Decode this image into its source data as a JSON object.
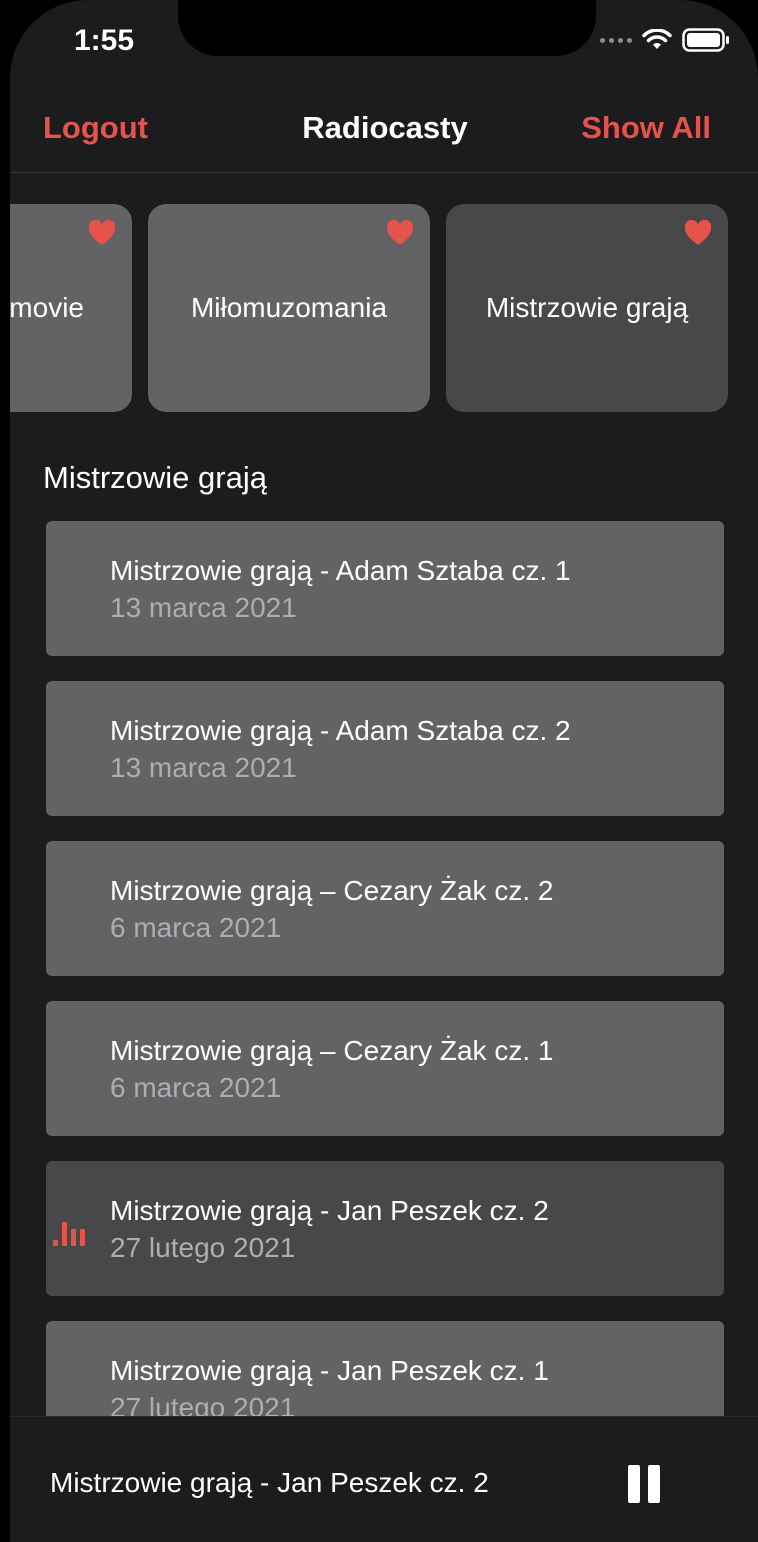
{
  "status": {
    "time": "1:55"
  },
  "navbar": {
    "left": "Logout",
    "title": "Radiocasty",
    "right": "Show All"
  },
  "colors": {
    "accent": "#e5534b",
    "card": "#636366",
    "card_selected": "#48484a",
    "background": "#1c1c1e"
  },
  "carousel": {
    "items": [
      {
        "label": "movie",
        "favorite": true
      },
      {
        "label": "Miłomuzomania",
        "favorite": true
      },
      {
        "label": "Mistrzowie grają",
        "favorite": true
      }
    ]
  },
  "section": {
    "title": "Mistrzowie grają"
  },
  "episodes": [
    {
      "title": "Mistrzowie grają - Adam Sztaba cz. 1",
      "date": "13 marca 2021"
    },
    {
      "title": "Mistrzowie grają - Adam Sztaba cz. 2",
      "date": "13 marca 2021"
    },
    {
      "title": "Mistrzowie grają – Cezary Żak cz. 2",
      "date": "6 marca 2021"
    },
    {
      "title": "Mistrzowie grają – Cezary Żak cz. 1",
      "date": "6 marca 2021"
    },
    {
      "title": "Mistrzowie grają - Jan Peszek cz. 2",
      "date": "27 lutego 2021",
      "playing": true
    },
    {
      "title": "Mistrzowie grają - Jan Peszek cz. 1",
      "date": "27 lutego 2021"
    }
  ],
  "player": {
    "title": "Mistrzowie grają - Jan Peszek cz. 2",
    "icon": "pause-icon"
  }
}
